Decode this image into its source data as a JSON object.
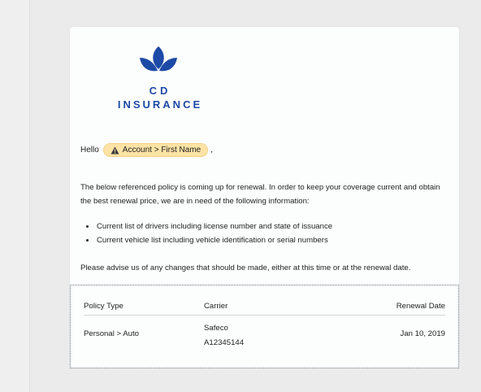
{
  "brand": {
    "line1": "CD",
    "line2": "INSURANCE",
    "color": "#1d4aa6",
    "icon": "leaf-logo-icon"
  },
  "greeting": {
    "prefix": "Hello",
    "merge_field": "Account > First Name",
    "merge_icon": "warning-icon",
    "suffix": ","
  },
  "body": {
    "intro": "The below referenced policy is coming up for renewal. In order to keep your coverage current and obtain the best renewal price, we are in need of the following information:",
    "bullets": [
      "Current list of drivers including license number and state of issuance",
      "Current vehicle list including vehicle identification or serial numbers"
    ],
    "closing": "Please advise us of any changes that should be made, either at this time or at the renewal date."
  },
  "policy_table": {
    "headers": [
      "Policy Type",
      "Carrier",
      "Renewal Date"
    ],
    "rows": [
      {
        "policy_type": "Personal > Auto",
        "carrier_name": "Safeco",
        "carrier_policy": "A12345144",
        "renewal_date": "Jan 10, 2019"
      }
    ]
  },
  "colors": {
    "chip_bg": "#fde3a5",
    "page_bg": "#ebebeb"
  }
}
